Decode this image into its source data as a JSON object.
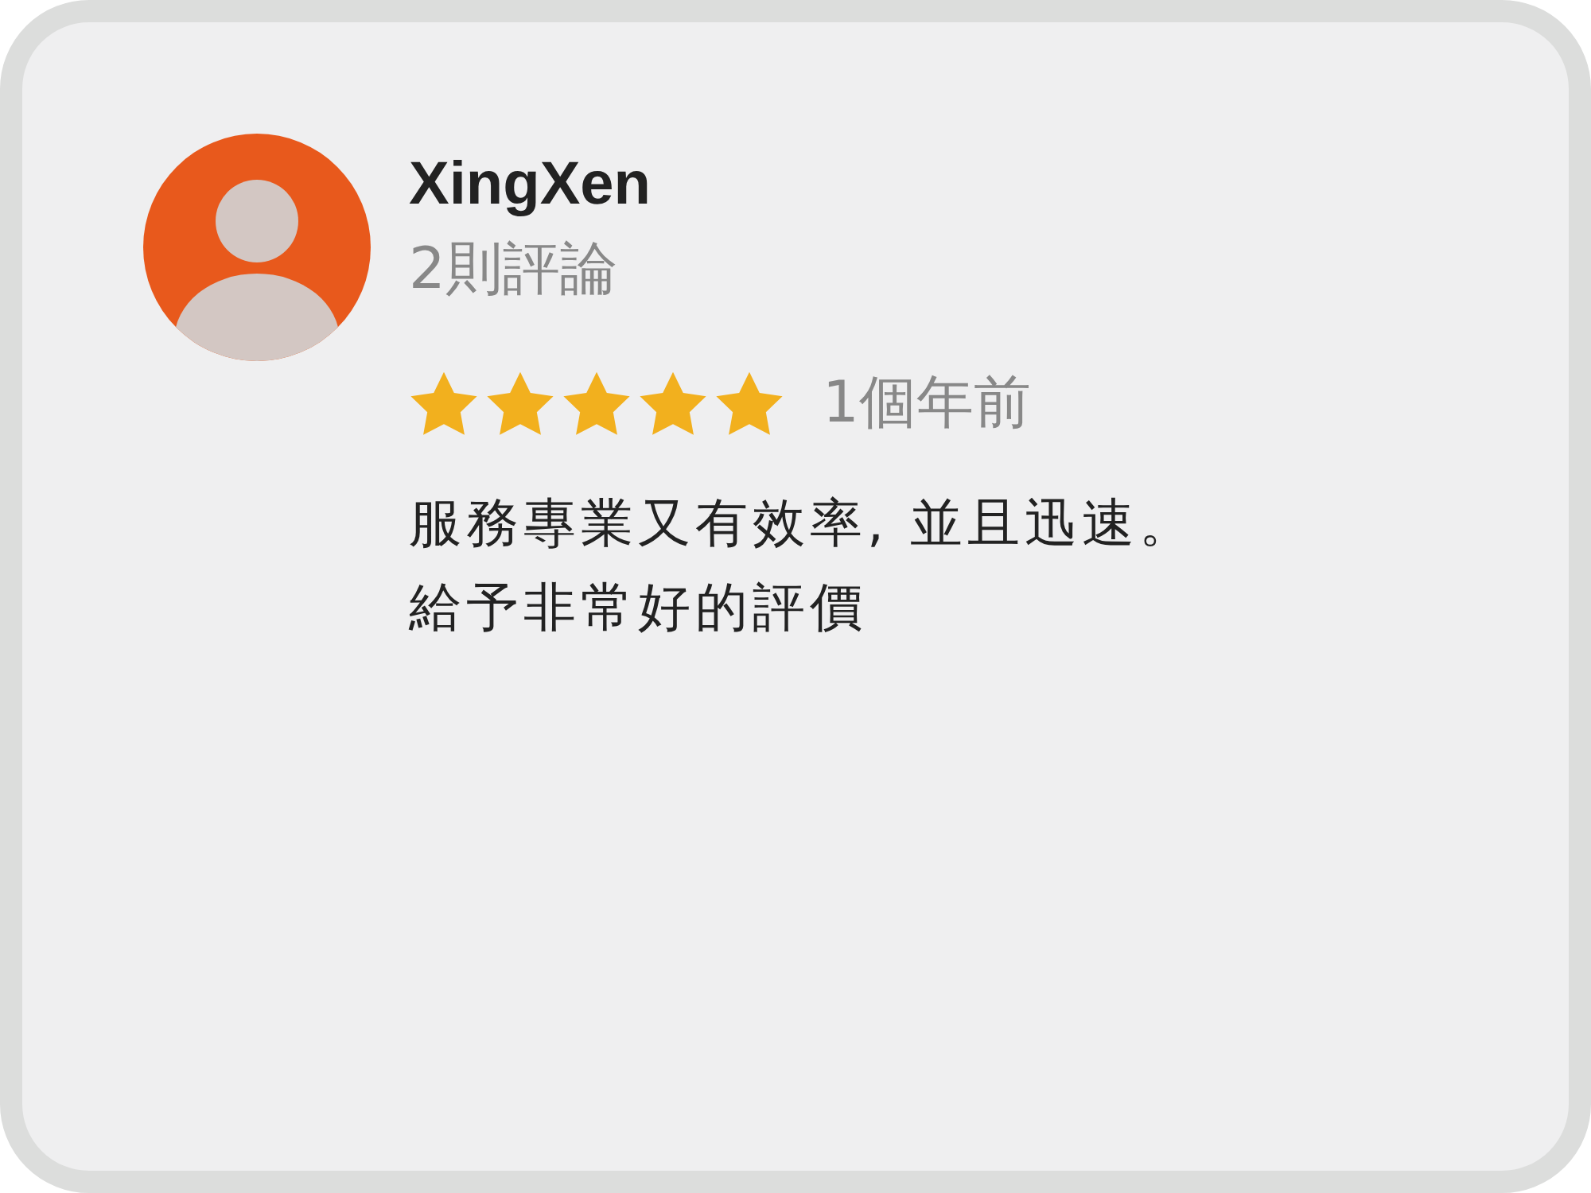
{
  "reviewer": {
    "name": "XingXen",
    "review_count": "2則評論"
  },
  "review": {
    "stars": 5,
    "time": "1個年前",
    "text_lines": [
      "服務專業又有效率, 並且迅速。",
      "給予非常好的評價"
    ]
  }
}
